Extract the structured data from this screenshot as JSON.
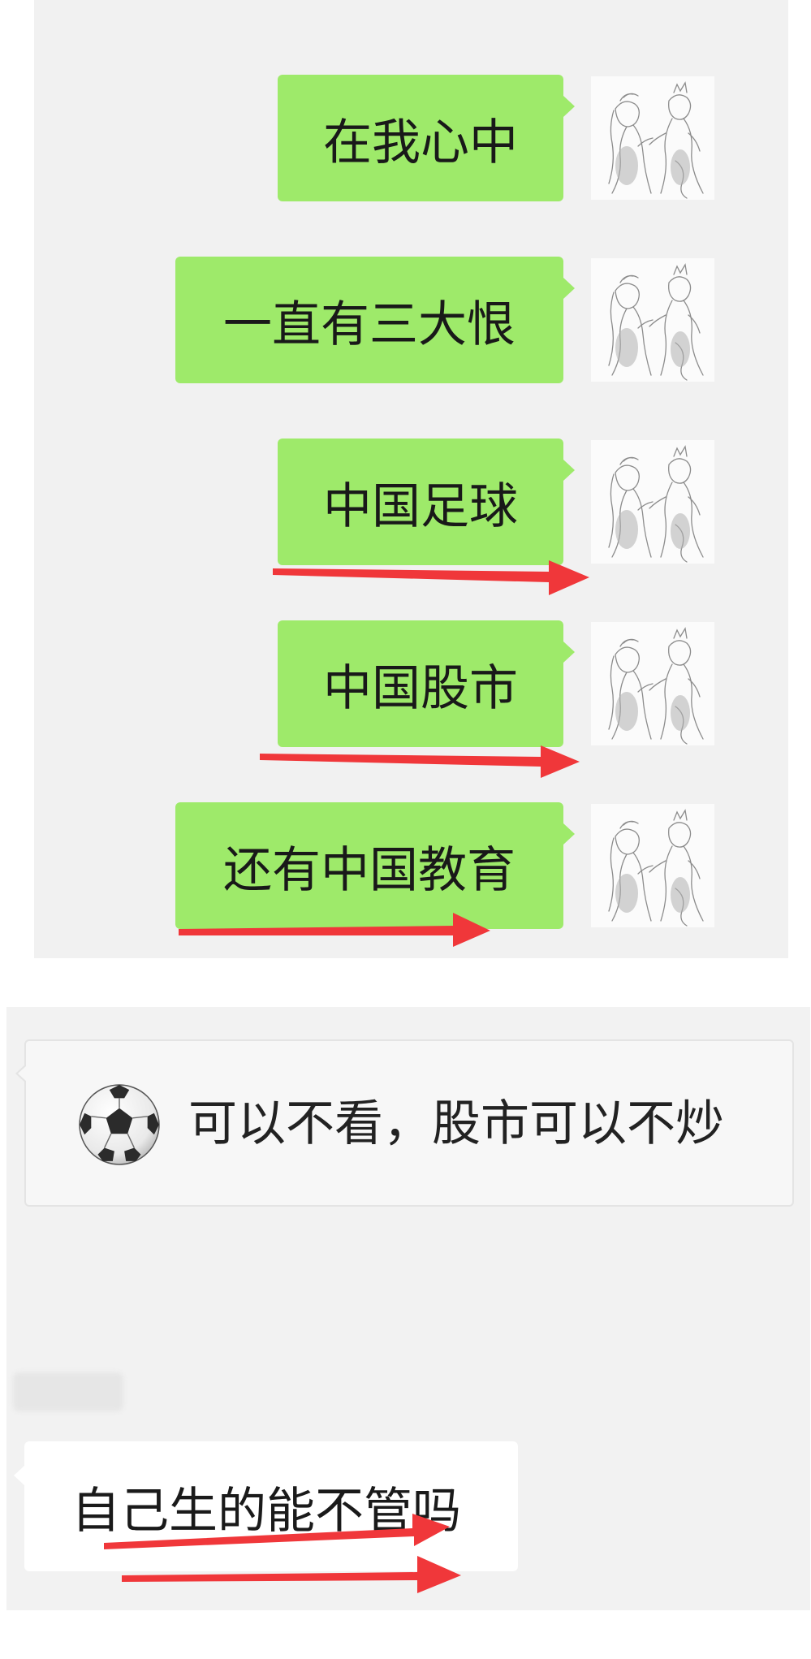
{
  "chat_top": {
    "messages": [
      {
        "text": "在我心中"
      },
      {
        "text": "一直有三大恨"
      },
      {
        "text": "中国足球"
      },
      {
        "text": "中国股市"
      },
      {
        "text": "还有中国教育"
      }
    ],
    "avatar_icon": "anime-couple-sketch-avatar-icon",
    "bubble_color": "#9eea6a"
  },
  "chat_bottom": {
    "ball_icon": "soccer-ball-icon",
    "ball_text": "可以不看，股市可以不炒",
    "reply_text": "自己生的能不管吗"
  },
  "annotation": {
    "arrow_color": "#f0373a"
  }
}
